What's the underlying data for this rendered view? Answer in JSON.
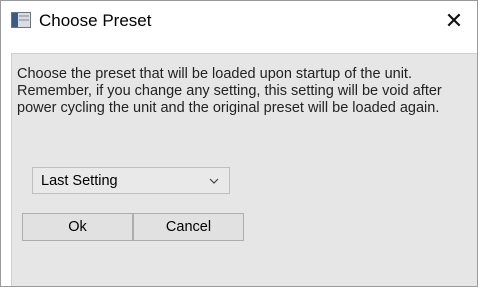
{
  "window": {
    "title": "Choose Preset",
    "close_glyph": "✕"
  },
  "dialog": {
    "message": "Choose the preset that will be loaded upon startup of the unit. Remember, if you change any setting, this setting will be void after power cycling the unit and the original preset will be loaded again.",
    "preset_select": {
      "selected": "Last Setting"
    },
    "ok_label": "Ok",
    "cancel_label": "Cancel"
  },
  "colors": {
    "title_background": "#ffffff",
    "dialog_background": "#e6e6e6",
    "button_background": "#e1e1e1",
    "button_border": "#adadad"
  },
  "icons": {
    "app_icon": "app-window-icon",
    "close_icon": "close-icon",
    "dropdown_icon": "chevron-down-icon"
  }
}
